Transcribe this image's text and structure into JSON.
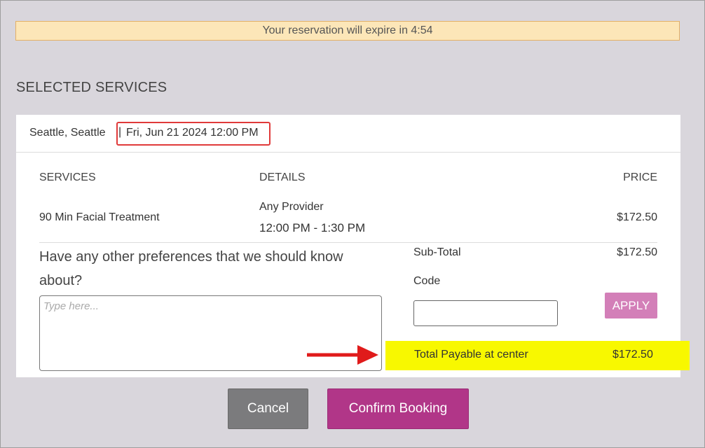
{
  "banner": {
    "text": "Your reservation will expire in 4:54"
  },
  "section": {
    "title": "SELECTED SERVICES"
  },
  "location": {
    "place": "Seattle, Seattle",
    "separator": "|",
    "datetime": "Fri, Jun 21 2024 12:00 PM"
  },
  "table": {
    "headers": {
      "services": "SERVICES",
      "details": "DETAILS",
      "price": "PRICE"
    },
    "rows": [
      {
        "service": "90 Min Facial Treatment",
        "provider": "Any Provider",
        "time": "12:00 PM - 1:30 PM",
        "price": "$172.50"
      }
    ]
  },
  "preferences": {
    "question": "Have any other preferences that we should know about?",
    "placeholder": "Type here..."
  },
  "summary": {
    "subtotal_label": "Sub-Total",
    "subtotal_value": "$172.50",
    "code_label": "Code",
    "apply_label": "APPLY",
    "total_label": "Total Payable at center",
    "total_value": "$172.50"
  },
  "actions": {
    "cancel_label": "Cancel",
    "confirm_label": "Confirm Booking"
  },
  "colors": {
    "banner_bg": "#fce6b8",
    "apply": "#d37fb8",
    "confirm": "#b13688",
    "cancel": "#7b7b7d",
    "highlight": "#f8f800",
    "annotation_red": "#e03a3a"
  },
  "icons": {
    "annotation_arrow": "right-arrow-icon"
  }
}
